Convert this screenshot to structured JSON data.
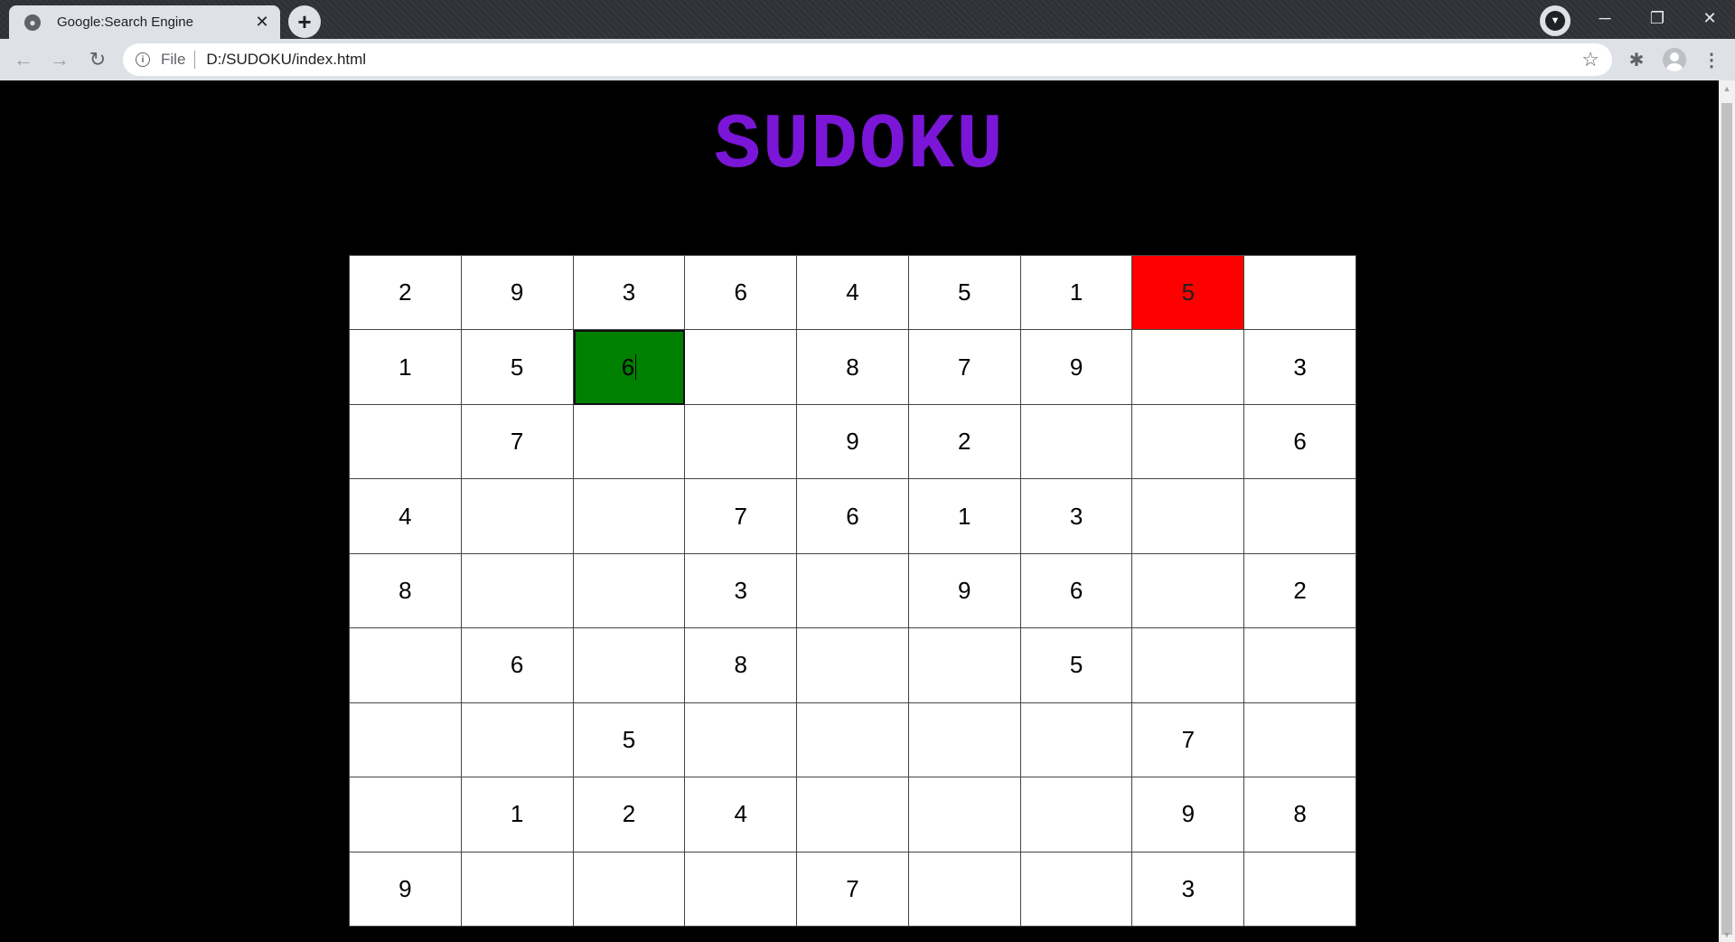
{
  "browser": {
    "tab_title": "Google:Search Engine",
    "tab_close": "✕",
    "new_tab": "+",
    "url_scheme": "File",
    "url": "D:/SUDOKU/index.html",
    "window_controls": {
      "minimize": "─",
      "restore": "❐",
      "close": "✕"
    },
    "icons": [
      "back-arrow-icon",
      "forward-arrow-icon",
      "reload-icon",
      "info-icon",
      "star-icon",
      "extensions-icon",
      "profile-icon",
      "menu-icon"
    ]
  },
  "page": {
    "title": "SUDOKU",
    "title_color": "#7b16d8"
  },
  "sudoku": {
    "colors": {
      "error": "#ff0000",
      "selected": "#008000"
    },
    "rows": [
      [
        "2",
        "9",
        "3",
        "6",
        "4",
        "5",
        "1",
        "5",
        ""
      ],
      [
        "1",
        "5",
        "6",
        "",
        "8",
        "7",
        "9",
        "",
        "3"
      ],
      [
        "",
        "7",
        "",
        "",
        "9",
        "2",
        "",
        "",
        "6"
      ],
      [
        "4",
        "",
        "",
        "7",
        "6",
        "1",
        "3",
        "",
        ""
      ],
      [
        "8",
        "",
        "",
        "3",
        "",
        "9",
        "6",
        "",
        "2"
      ],
      [
        "",
        "6",
        "",
        "8",
        "",
        "",
        "5",
        "",
        ""
      ],
      [
        "",
        "",
        "5",
        "",
        "",
        "",
        "",
        "7",
        ""
      ],
      [
        "",
        "1",
        "2",
        "4",
        "",
        "",
        "",
        "9",
        "8"
      ],
      [
        "9",
        "",
        "",
        "",
        "7",
        "",
        "",
        "3",
        ""
      ]
    ],
    "error_cells": [
      [
        0,
        7
      ]
    ],
    "selected_cell": [
      1,
      2
    ]
  }
}
